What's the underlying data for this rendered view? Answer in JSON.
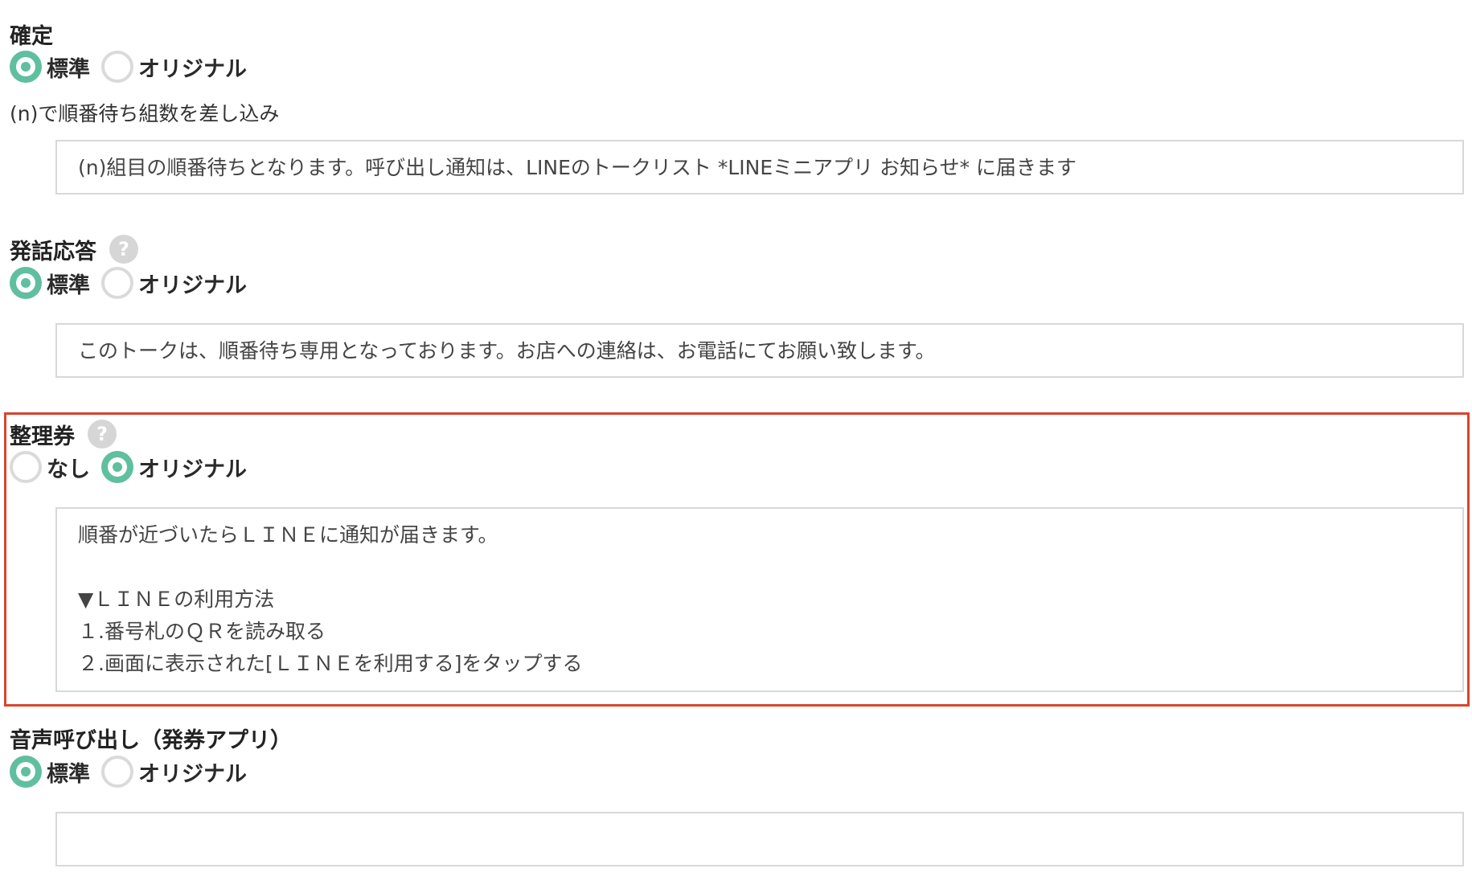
{
  "sections": {
    "confirm": {
      "title": "確定",
      "options": [
        "標準",
        "オリジナル"
      ],
      "selected": "標準",
      "hint": "(n)で順番待ち組数を差し込み",
      "message": "(n)組目の順番待ちとなります。呼び出し通知は、LINEのトークリスト *LINEミニアプリ お知らせ* に届きます"
    },
    "auto_reply": {
      "title": "発話応答",
      "help_icon": "?",
      "options": [
        "標準",
        "オリジナル"
      ],
      "selected": "標準",
      "message": "このトークは、順番待ち専用となっております。お店への連絡は、お電話にてお願い致します。"
    },
    "ticket": {
      "title": "整理券",
      "help_icon": "?",
      "options": [
        "なし",
        "オリジナル"
      ],
      "selected": "オリジナル",
      "message_lines": [
        "順番が近づいたらＬＩＮＥに通知が届きます。",
        "",
        "▼ＬＩＮＥの利用方法",
        "１.番号札のＱＲを読み取る",
        "２.画面に表示された[ＬＩＮＥを利用する]をタップする"
      ]
    },
    "voice_call": {
      "title": "音声呼び出し（発券アプリ）",
      "options": [
        "標準",
        "オリジナル"
      ],
      "selected": "標準",
      "message": ""
    }
  },
  "colors": {
    "radio_checked": "#5fbf9f",
    "radio_unchecked_border": "#dadada",
    "highlight_border": "#d9442e",
    "box_border": "#d8d8d8"
  }
}
